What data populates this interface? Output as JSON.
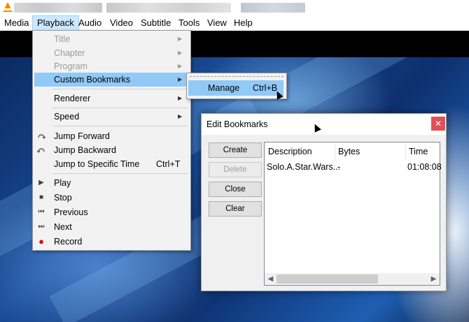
{
  "menubar": [
    "Media",
    "Playback",
    "Audio",
    "Video",
    "Subtitle",
    "Tools",
    "View",
    "Help"
  ],
  "playback_menu": {
    "items": [
      {
        "label": "Title",
        "arrow": "▶",
        "disabled": true
      },
      {
        "label": "Chapter",
        "arrow": "▶",
        "disabled": true
      },
      {
        "label": "Program",
        "arrow": "▶",
        "disabled": true
      },
      {
        "label": "Custom Bookmarks",
        "arrow": "▶"
      },
      {
        "label": "Renderer",
        "arrow": "▶"
      },
      {
        "label": "Speed",
        "arrow": "▶"
      },
      {
        "label": "Jump Forward",
        "icon": "jump-forward-icon"
      },
      {
        "label": "Jump Backward",
        "icon": "jump-backward-icon"
      },
      {
        "label": "Jump to Specific Time",
        "shortcut": "Ctrl+T"
      },
      {
        "label": "Play",
        "icon": "play-icon",
        "glyph": "▶"
      },
      {
        "label": "Stop",
        "icon": "stop-icon",
        "glyph": "■"
      },
      {
        "label": "Previous",
        "icon": "previous-icon",
        "glyph": "⏮"
      },
      {
        "label": "Next",
        "icon": "next-icon",
        "glyph": "⏭"
      },
      {
        "label": "Record",
        "icon": "record-icon",
        "glyph": "●"
      }
    ]
  },
  "bookmarks_submenu": {
    "label": "Manage",
    "shortcut": "Ctrl+B"
  },
  "dialog": {
    "title": "Edit Bookmarks",
    "close_glyph": "✕",
    "buttons": {
      "create": "Create",
      "delete": "Delete",
      "close": "Close",
      "clear": "Clear"
    },
    "columns": [
      "Description",
      "Bytes",
      "Time"
    ],
    "rows": [
      {
        "description": "Solo.A.Star.Wars...",
        "bytes": "-",
        "time": "01:08:08"
      }
    ],
    "scroll_left": "◀",
    "scroll_right": "▶"
  },
  "colors": {
    "highlight": "#91c9f7",
    "menubar_active": "#cce8ff",
    "record": "#e00000",
    "close": "#e0505a"
  }
}
